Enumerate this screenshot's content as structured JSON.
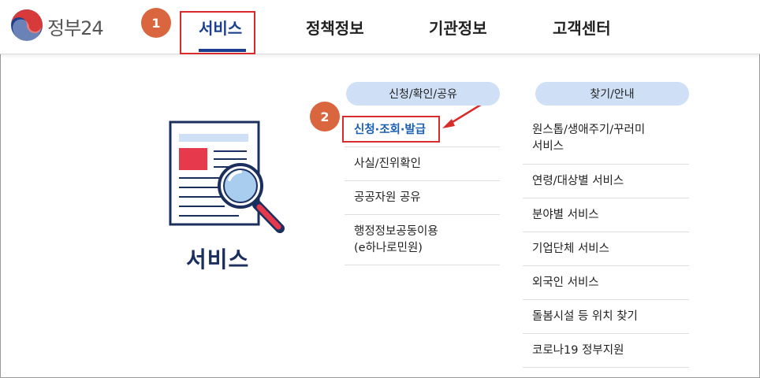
{
  "header": {
    "logo_text": "정부24",
    "nav": [
      {
        "label": "서비스"
      },
      {
        "label": "정책정보"
      },
      {
        "label": "기관정보"
      },
      {
        "label": "고객센터"
      }
    ]
  },
  "steps": {
    "step1": "1",
    "step2": "2"
  },
  "left_panel": {
    "title": "서비스",
    "icon": "document-search-icon"
  },
  "column1": {
    "header": "신청/확인/공유",
    "items": [
      {
        "label": "신청·조회·발급"
      },
      {
        "label": "사실/진위확인"
      },
      {
        "label": "공공자원 공유"
      },
      {
        "label": "행정정보공동이용\n(e하나로민원)"
      }
    ]
  },
  "column2": {
    "header": "찾기/안내",
    "items": [
      {
        "label": "원스톱/생애주기/꾸러미\n서비스"
      },
      {
        "label": "연령/대상별 서비스"
      },
      {
        "label": "분야별 서비스"
      },
      {
        "label": "기업단체 서비스"
      },
      {
        "label": "외국인 서비스"
      },
      {
        "label": "돌봄시설 등 위치 찾기"
      },
      {
        "label": "코로나19 정부지원"
      }
    ]
  },
  "colors": {
    "accent_navy": "#1b3f8e",
    "highlight_red": "#d92b2b",
    "badge_orange": "#d9663e",
    "pill_blue": "#cfe0f6",
    "link_blue": "#1b5fb0"
  }
}
